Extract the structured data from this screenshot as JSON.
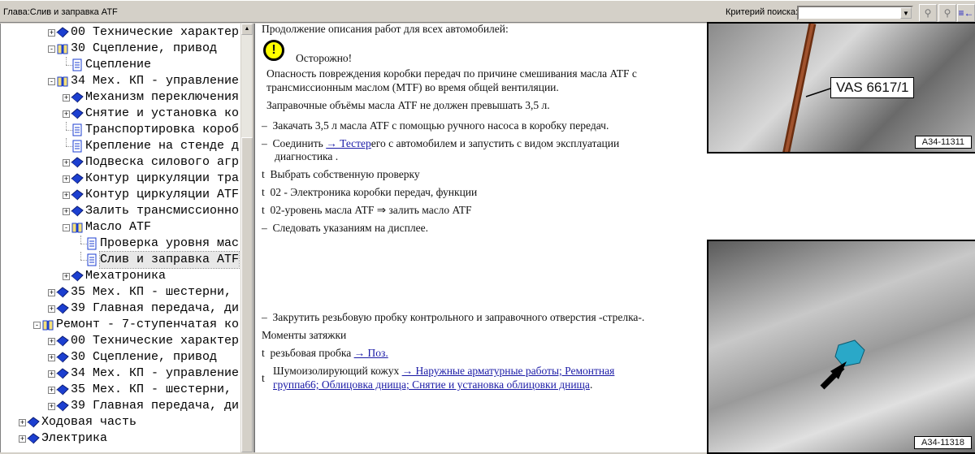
{
  "header": {
    "chapter": "Глава:Слив и заправка ATF",
    "search_label": "Критерий поиска:",
    "search_value": ""
  },
  "tree": [
    {
      "label": "00 Технические характер",
      "level": 2,
      "type": "book",
      "exp": "+"
    },
    {
      "label": "30 Сцепление, привод",
      "level": 2,
      "type": "open",
      "exp": "-"
    },
    {
      "label": "Сцепление",
      "level": 3,
      "type": "page",
      "exp": ""
    },
    {
      "label": "34 Мех. КП - управление",
      "level": 2,
      "type": "open",
      "exp": "-"
    },
    {
      "label": "Механизм переключения",
      "level": 3,
      "type": "book",
      "exp": "+"
    },
    {
      "label": "Снятие и установка ко",
      "level": 3,
      "type": "book",
      "exp": "+"
    },
    {
      "label": "Транспортировка короб",
      "level": 3,
      "type": "page",
      "exp": ""
    },
    {
      "label": "Крепление на стенде д",
      "level": 3,
      "type": "page",
      "exp": ""
    },
    {
      "label": "Подвеска силового агр",
      "level": 3,
      "type": "book",
      "exp": "+"
    },
    {
      "label": "Контур циркуляции тра",
      "level": 3,
      "type": "book",
      "exp": "+"
    },
    {
      "label": "Контур циркуляции ATF",
      "level": 3,
      "type": "book",
      "exp": "+"
    },
    {
      "label": "Залить трансмиссионно",
      "level": 3,
      "type": "book",
      "exp": "+"
    },
    {
      "label": "Масло ATF",
      "level": 3,
      "type": "open",
      "exp": "-"
    },
    {
      "label": "Проверка уровня мас",
      "level": 4,
      "type": "page",
      "exp": ""
    },
    {
      "label": "Слив и заправка ATF",
      "level": 4,
      "type": "page",
      "exp": "",
      "selected": true
    },
    {
      "label": "Мехатроника",
      "level": 3,
      "type": "book",
      "exp": "+"
    },
    {
      "label": "35 Мех. КП - шестерни,",
      "level": 2,
      "type": "book",
      "exp": "+"
    },
    {
      "label": "39 Главная передача, ди",
      "level": 2,
      "type": "book",
      "exp": "+"
    },
    {
      "label": "Ремонт - 7-ступенчатая ко",
      "level": 1,
      "type": "open",
      "exp": "-"
    },
    {
      "label": "00 Технические характер",
      "level": 2,
      "type": "book",
      "exp": "+"
    },
    {
      "label": "30 Сцепление, привод",
      "level": 2,
      "type": "book",
      "exp": "+"
    },
    {
      "label": "34 Мех. КП - управление",
      "level": 2,
      "type": "book",
      "exp": "+"
    },
    {
      "label": "35 Мех. КП - шестерни,",
      "level": 2,
      "type": "book",
      "exp": "+"
    },
    {
      "label": "39 Главная передача, ди",
      "level": 2,
      "type": "book",
      "exp": "+"
    },
    {
      "label": "Ходовая часть",
      "level": 0,
      "type": "book",
      "exp": "+"
    },
    {
      "label": "Электрика",
      "level": 0,
      "type": "book",
      "exp": "+"
    }
  ],
  "content": {
    "intro": "Продолжение описания работ для всех автомобилей:",
    "caution": "Осторожно!",
    "warning_1": "Опасность повреждения коробки передач по причине смешивания масла ATF с",
    "warning_2": "трансмиссионным маслом (MTF) во время общей вентиляции.",
    "volume": "Заправочные объёмы масла ATF не должен превышать 3,5 л.",
    "step1": "Закачать 3,5 л масла ATF с помощью ручного насоса в коробку передач.",
    "step2_a": "Соединить ",
    "step2_link": "→ Тестер",
    "step2_b": "его с автомобилем и запустить с видом эксплуатации",
    "step2_c": "диагностика .",
    "sub1": "Выбрать собственную проверку",
    "sub2": "02 - Электроника коробки передач, функции",
    "sub3": "02-уровень масла ATF ⇒ залить масло ATF",
    "step3": "Следовать указаниям на дисплее.",
    "step4": "Закрутить резьбовую пробку контрольного и заправочного отверстия -стрелка-.",
    "torque_title": "Моменты затяжки",
    "torque1": "резьбовая пробка ",
    "torque1_link": "→ Поз.",
    "torque2": "Шумоизолирующий кожух ",
    "torque2_link1": "→ Наружные арматурные работы; Ремонтная",
    "torque2_link2": "группа66; Облицовка днища; Снятие и установка облицовки днища",
    "dash": "–",
    "bullet": "t",
    "dot": "."
  },
  "figures": {
    "fig1_label": "A34-11311",
    "fig1_callout": "VAS 6617/1",
    "fig2_label": "A34-11318"
  }
}
